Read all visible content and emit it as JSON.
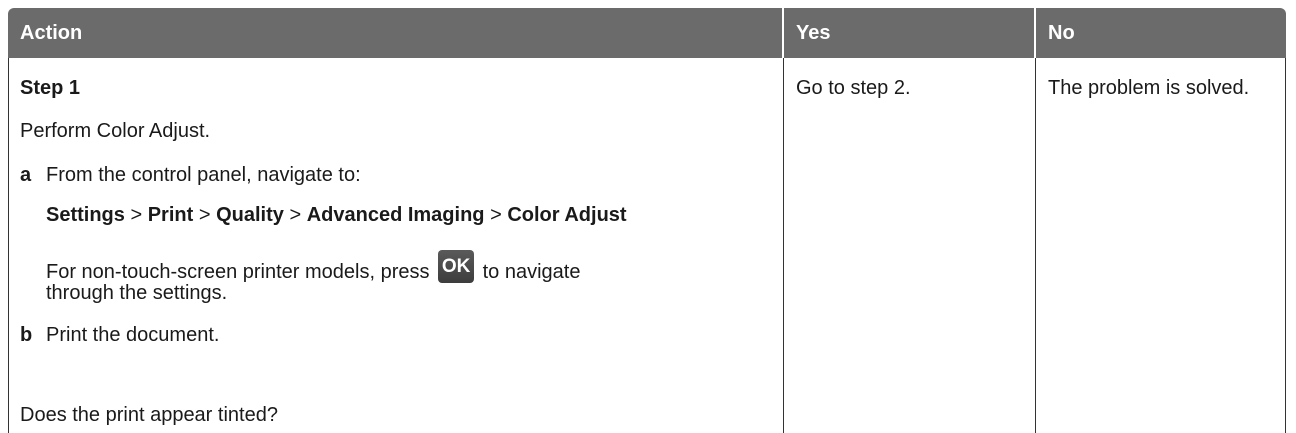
{
  "table": {
    "headers": {
      "action": "Action",
      "yes": "Yes",
      "no": "No"
    },
    "row1": {
      "step_title": "Step 1",
      "intro": "Perform Color Adjust.",
      "substep_a_letter": "a",
      "substep_a_text": "From the control panel, navigate to:",
      "path": {
        "settings": "Settings",
        "print": "Print",
        "quality": "Quality",
        "advanced_imaging": "Advanced Imaging",
        "color_adjust": "Color Adjust",
        "separator": ">"
      },
      "nontouch_before": "For non-touch-screen printer models, press",
      "ok_button_label": "OK",
      "nontouch_after": "to navigate",
      "nontouch_line2": "through the settings.",
      "substep_b_letter": "b",
      "substep_b_text": "Print the document.",
      "question": "Does the print appear tinted?",
      "yes_text": "Go to step 2.",
      "no_text": "The problem is solved."
    }
  },
  "colors": {
    "header_bg": "#6b6b6b",
    "header_text": "#ffffff",
    "rule": "#333333"
  },
  "icons": {
    "ok_button": "ok-button-icon"
  }
}
